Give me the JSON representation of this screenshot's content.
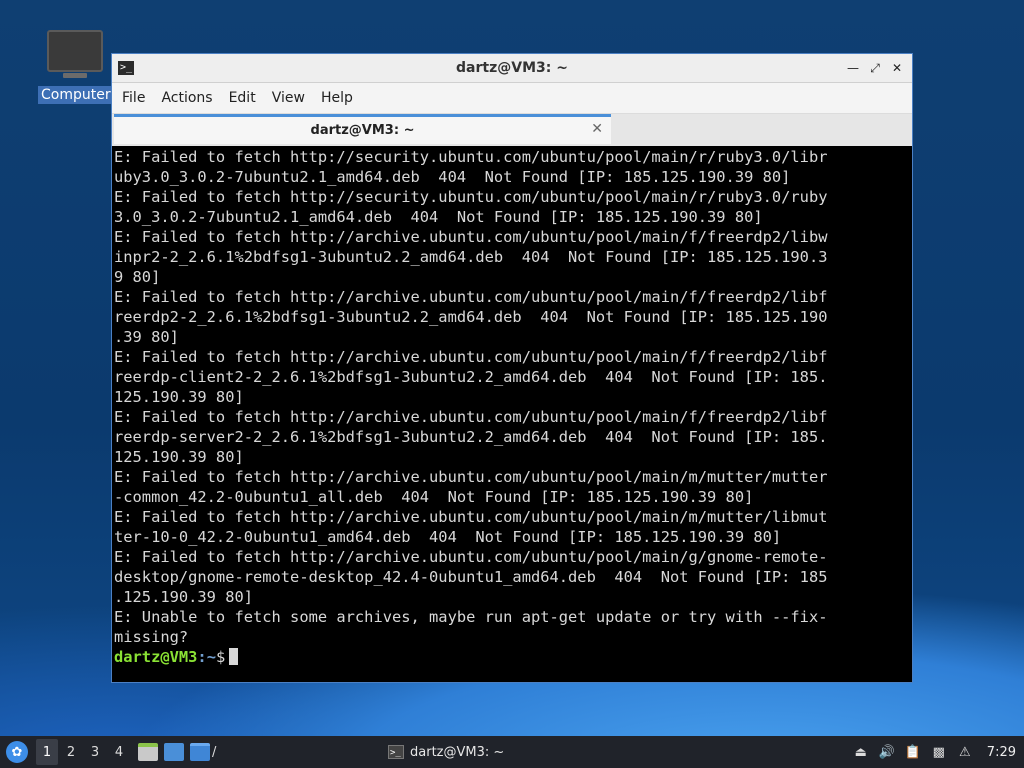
{
  "desktop": {
    "icons": [
      {
        "label": "Computer"
      }
    ]
  },
  "window": {
    "title": "dartz@VM3: ~",
    "menu": [
      "File",
      "Actions",
      "Edit",
      "View",
      "Help"
    ],
    "tab": {
      "label": "dartz@VM3: ~"
    },
    "terminal_lines": [
      "E: Failed to fetch http://security.ubuntu.com/ubuntu/pool/main/r/ruby3.0/libr",
      "uby3.0_3.0.2-7ubuntu2.1_amd64.deb  404  Not Found [IP: 185.125.190.39 80]",
      "E: Failed to fetch http://security.ubuntu.com/ubuntu/pool/main/r/ruby3.0/ruby",
      "3.0_3.0.2-7ubuntu2.1_amd64.deb  404  Not Found [IP: 185.125.190.39 80]",
      "E: Failed to fetch http://archive.ubuntu.com/ubuntu/pool/main/f/freerdp2/libw",
      "inpr2-2_2.6.1%2bdfsg1-3ubuntu2.2_amd64.deb  404  Not Found [IP: 185.125.190.3",
      "9 80]",
      "E: Failed to fetch http://archive.ubuntu.com/ubuntu/pool/main/f/freerdp2/libf",
      "reerdp2-2_2.6.1%2bdfsg1-3ubuntu2.2_amd64.deb  404  Not Found [IP: 185.125.190",
      ".39 80]",
      "E: Failed to fetch http://archive.ubuntu.com/ubuntu/pool/main/f/freerdp2/libf",
      "reerdp-client2-2_2.6.1%2bdfsg1-3ubuntu2.2_amd64.deb  404  Not Found [IP: 185.",
      "125.190.39 80]",
      "E: Failed to fetch http://archive.ubuntu.com/ubuntu/pool/main/f/freerdp2/libf",
      "reerdp-server2-2_2.6.1%2bdfsg1-3ubuntu2.2_amd64.deb  404  Not Found [IP: 185.",
      "125.190.39 80]",
      "E: Failed to fetch http://archive.ubuntu.com/ubuntu/pool/main/m/mutter/mutter",
      "-common_42.2-0ubuntu1_all.deb  404  Not Found [IP: 185.125.190.39 80]",
      "E: Failed to fetch http://archive.ubuntu.com/ubuntu/pool/main/m/mutter/libmut",
      "ter-10-0_42.2-0ubuntu1_amd64.deb  404  Not Found [IP: 185.125.190.39 80]",
      "E: Failed to fetch http://archive.ubuntu.com/ubuntu/pool/main/g/gnome-remote-",
      "desktop/gnome-remote-desktop_42.4-0ubuntu1_amd64.deb  404  Not Found [IP: 185",
      ".125.190.39 80]",
      "E: Unable to fetch some archives, maybe run apt-get update or try with --fix-",
      "missing?"
    ],
    "prompt": {
      "user_host": "dartz@VM3",
      "sep": ":",
      "path": "~",
      "symbol": "$"
    }
  },
  "taskbar": {
    "workspaces": [
      "1",
      "2",
      "3",
      "4"
    ],
    "active_workspace": "1",
    "launcher_path_label": "/",
    "task": {
      "label": "dartz@VM3: ~"
    },
    "clock": "7:29"
  }
}
